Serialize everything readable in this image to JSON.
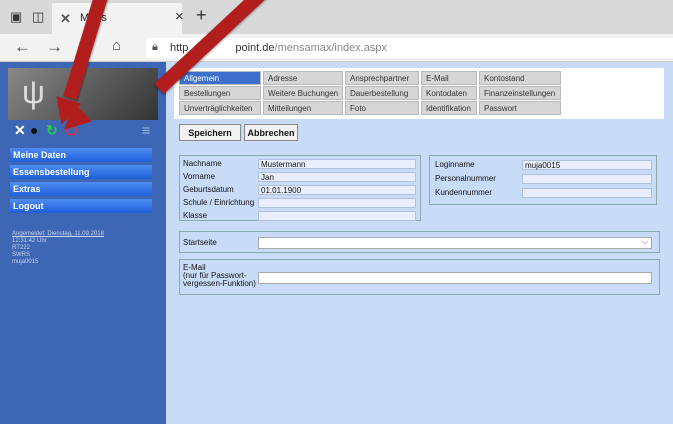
{
  "browser": {
    "tab_title": "Mens",
    "tab_close": "×",
    "new_tab": "+",
    "url_host": "http",
    "url_domain": "point.de",
    "url_path": "/mensamax/index.aspx",
    "icons": {
      "tab_manager": "tab-manager-icon",
      "back": "back-arrow-icon",
      "forward": "forward-arrow-icon",
      "reload": "reload-icon",
      "home": "home-icon",
      "lock": "lock-icon"
    }
  },
  "sidebar": {
    "menu": [
      {
        "label": "Meine Daten"
      },
      {
        "label": "Essensbestellung"
      },
      {
        "label": "Extras"
      },
      {
        "label": "Logout"
      }
    ],
    "info_lines": [
      "Angemeldet: Dienstag, 11.09.2018",
      "12:31:42 Uhr",
      "RT222",
      "SWRS",
      "muja0015"
    ]
  },
  "tabs": {
    "row1": [
      "Allgemein",
      "Adresse",
      "Ansprechpartner",
      "E-Mail",
      "Kontostand"
    ],
    "row2": [
      "Bestellungen",
      "Weitere Buchungen",
      "Dauerbestellung",
      "Kontodaten",
      "Finanzeinstellungen"
    ],
    "row3": [
      "Unverträglichkeiten",
      "Mitteilungen",
      "Foto",
      "Identifikation",
      "Passwort"
    ]
  },
  "buttons": {
    "save": "Speichern",
    "cancel": "Abbrechen"
  },
  "personal": {
    "labels": [
      "Nachname",
      "Vorname",
      "Geburtsdatum",
      "Schule / Einrichtung",
      "Klasse"
    ],
    "values": [
      "Mustermann",
      "Jan",
      "01.01.1900",
      "",
      ""
    ]
  },
  "login": {
    "labels": [
      "Loginname",
      "Personalnummer",
      "Kundennummer"
    ],
    "values": [
      "muja0015",
      "",
      ""
    ]
  },
  "startseite": {
    "label": "Startseite",
    "value": ""
  },
  "email": {
    "label_line1": "E-Mail",
    "label_line2": "(nur für Passwort-",
    "label_line3": "vergessen-Funktion)",
    "value": ""
  },
  "colors": {
    "sidebar": "#3d67b4",
    "menu_item": "#2a6ee6",
    "active_tab": "#3d6fcc",
    "page_bg": "#c8dcf8",
    "arrow": "#b21e1e"
  }
}
